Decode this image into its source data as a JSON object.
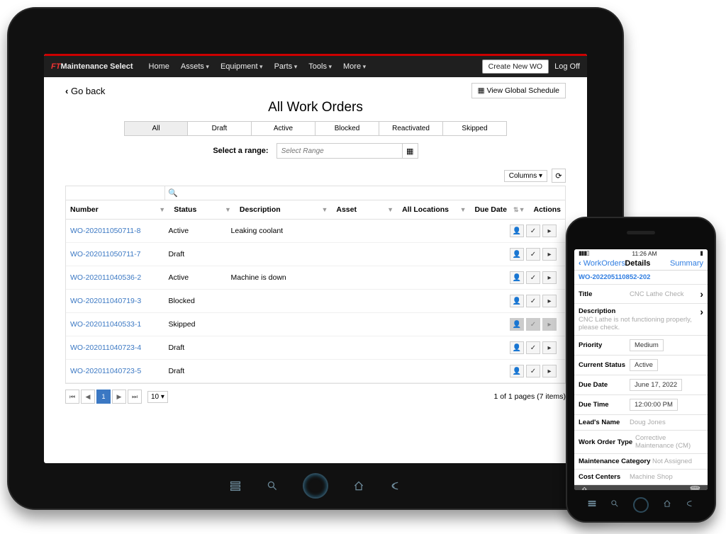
{
  "brand": {
    "ft": "FT",
    "rest": "Maintenance Select"
  },
  "nav": {
    "home": "Home",
    "assets": "Assets",
    "equipment": "Equipment",
    "parts": "Parts",
    "tools": "Tools",
    "more": "More",
    "create": "Create New WO",
    "logoff": "Log Off"
  },
  "goback": "Go back",
  "view_global": "View Global Schedule",
  "page_title": "All Work Orders",
  "filters": {
    "all": "All",
    "draft": "Draft",
    "active": "Active",
    "blocked": "Blocked",
    "reactivated": "Reactivated",
    "skipped": "Skipped"
  },
  "range_label": "Select a range:",
  "range_placeholder": "Select Range",
  "columns_btn": "Columns ▾",
  "headers": {
    "number": "Number",
    "status": "Status",
    "description": "Description",
    "asset": "Asset",
    "locations": "All Locations",
    "due": "Due Date",
    "actions": "Actions"
  },
  "rows": [
    {
      "num": "WO-202011050711-8",
      "status": "Active",
      "desc": "Leaking coolant",
      "skipped": false
    },
    {
      "num": "WO-202011050711-7",
      "status": "Draft",
      "desc": "",
      "skipped": false
    },
    {
      "num": "WO-202011040536-2",
      "status": "Active",
      "desc": "Machine is down",
      "skipped": false
    },
    {
      "num": "WO-202011040719-3",
      "status": "Blocked",
      "desc": "",
      "skipped": false
    },
    {
      "num": "WO-202011040533-1",
      "status": "Skipped",
      "desc": "",
      "skipped": true
    },
    {
      "num": "WO-202011040723-4",
      "status": "Draft",
      "desc": "",
      "skipped": false
    },
    {
      "num": "WO-202011040723-5",
      "status": "Draft",
      "desc": "",
      "skipped": false
    }
  ],
  "pager": {
    "current": "1",
    "size": "10 ▾",
    "info": "1 of 1 pages (7 items)",
    "first": "⏮",
    "prev": "◀",
    "next": "▶",
    "last": "⏭"
  },
  "phone": {
    "time": "11:26 AM",
    "carrier": "",
    "back": "WorkOrders",
    "title": "Details",
    "summary": "Summary",
    "id": "WO-202205110852-202",
    "fields": {
      "title_lbl": "Title",
      "title_val": "CNC Lathe Check",
      "desc_lbl": "Description",
      "desc_val": "CNC Lathe is not functioning properly, please check.",
      "priority_lbl": "Priority",
      "priority_val": "Medium",
      "status_lbl": "Current Status",
      "status_val": "Active",
      "due_date_lbl": "Due Date",
      "due_date_val": "June 17, 2022",
      "due_time_lbl": "Due Time",
      "due_time_val": "12:00:00 PM",
      "lead_lbl": "Lead's Name",
      "lead_val": "Doug Jones",
      "wotype_lbl": "Work Order Type",
      "wotype_val": "Corrective Maintenance (CM)",
      "maintcat_lbl": "Maintenance Category",
      "maintcat_val": "Not Assigned",
      "cost_lbl": "Cost Centers",
      "cost_val": "Machine Shop"
    }
  }
}
